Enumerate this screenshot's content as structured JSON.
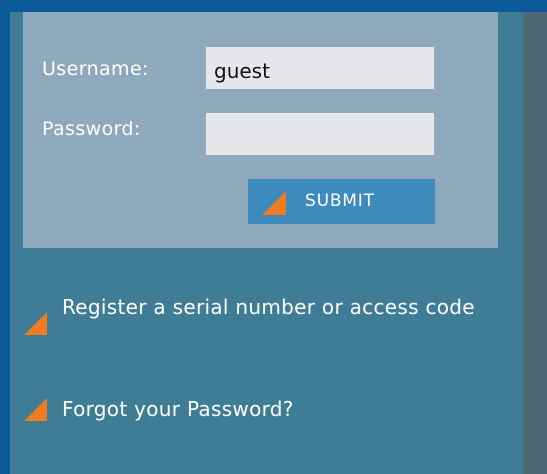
{
  "login": {
    "username_label": "Username:",
    "username_value": "guest",
    "password_label": "Password:",
    "password_value": "",
    "submit_label": "SUBMIT"
  },
  "links": {
    "register": "Register a serial number or access code",
    "forgot_password": "Forgot your Password?"
  },
  "colors": {
    "frame_border": "#0b5a9a",
    "sidebar_bg": "#3f7d96",
    "login_panel_bg": "#8ea9bc",
    "input_bg": "#e6e7ea",
    "button_bg": "#3d8bbd",
    "accent_orange": "#f07b22",
    "right_strip": "#4e6973"
  }
}
